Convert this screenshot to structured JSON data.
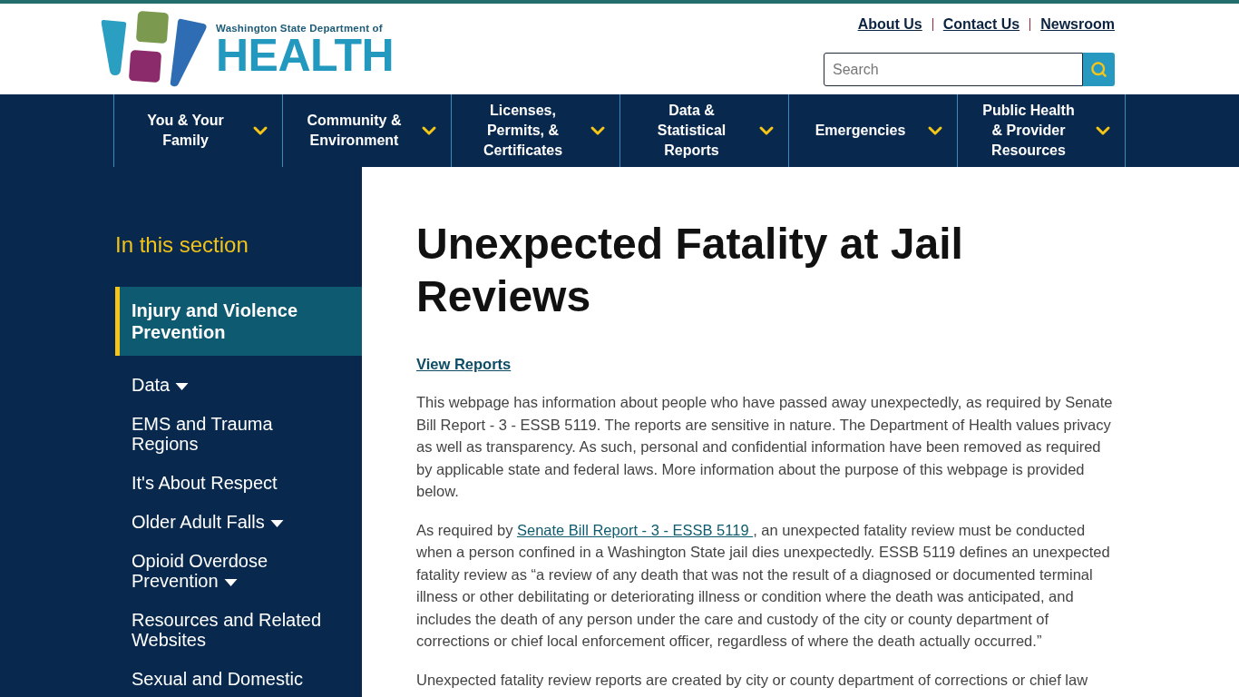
{
  "header": {
    "logo": {
      "subtitle": "Washington State Department of",
      "title": "HEALTH"
    },
    "utility_links": [
      "About Us",
      "Contact Us",
      "Newsroom"
    ],
    "search": {
      "placeholder": "Search"
    }
  },
  "nav": {
    "items": [
      {
        "label": "You & Your Family"
      },
      {
        "label": "Community & Environment"
      },
      {
        "label": "Licenses, Permits, & Certificates"
      },
      {
        "label": "Data & Statistical Reports"
      },
      {
        "label": "Emergencies"
      },
      {
        "label": "Public Health & Provider Resources"
      }
    ]
  },
  "sidebar": {
    "heading": "In this section",
    "items": [
      {
        "label": "Injury and Violence Prevention",
        "selected": true,
        "has_submenu": false
      },
      {
        "label": "Data",
        "selected": false,
        "has_submenu": true
      },
      {
        "label": "EMS and Trauma Regions",
        "selected": false,
        "has_submenu": false
      },
      {
        "label": "It's About Respect",
        "selected": false,
        "has_submenu": false
      },
      {
        "label": "Older Adult Falls",
        "selected": false,
        "has_submenu": true
      },
      {
        "label": "Opioid Overdose Prevention",
        "selected": false,
        "has_submenu": true
      },
      {
        "label": "Resources and Related Websites",
        "selected": false,
        "has_submenu": false
      },
      {
        "label": "Sexual and Domestic",
        "selected": false,
        "has_submenu": false
      }
    ]
  },
  "main": {
    "title": "Unexpected Fatality at Jail Reviews",
    "view_reports_link": "View Reports",
    "paragraphs": [
      {
        "kind": "text",
        "text": "This webpage has information about people who have passed away unexpectedly, as required by Senate Bill Report - 3 - ESSB 5119. The reports are sensitive in nature. The Department of Health values privacy as well as transparency. As such, personal and confidential information have been removed as required by applicable state and federal laws. More information about the purpose of this webpage is provided below."
      },
      {
        "kind": "with_link",
        "before": "As required by ",
        "link": "Senate Bill Report - 3 - ESSB 5119 ",
        "after": ", an unexpected fatality review must be conducted when a person confined in a Washington State jail dies unexpectedly. ESSB 5119 defines an unexpected fatality review as “a review of any death that was not the result of a diagnosed or documented terminal illness or other debilitating or deteriorating illness or condition where the death was anticipated, and includes the death of any person under the care and custody of the city or county department of corrections or chief local enforcement officer, regardless of where the death actually occurred.”"
      },
      {
        "kind": "text",
        "text": "Unexpected fatality review reports are created by city or county department of corrections or chief law"
      }
    ]
  }
}
